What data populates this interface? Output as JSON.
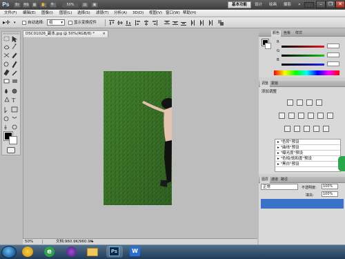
{
  "app": {
    "logo": "Ps",
    "workspace_active": "基本功能",
    "workspace_links": [
      "设计",
      "绘画",
      "摄影"
    ],
    "workspace_more": "»",
    "zoom": "50%"
  },
  "menu": {
    "items": [
      "文件(F)",
      "编辑(E)",
      "图像(I)",
      "图层(L)",
      "选择(S)",
      "滤镜(T)",
      "分析(A)",
      "3D(D)",
      "视图(V)",
      "窗口(W)",
      "帮助(H)"
    ]
  },
  "options": {
    "auto_select_label": "自动选择:",
    "auto_select_value": "组",
    "show_transform_label": "显示变换控件"
  },
  "document": {
    "tab_title": "DSC01026_副本.jpg @ 50%(RGB/8) *",
    "status_zoom": "50%",
    "status_doc": "文档:960.9K/960.9K"
  },
  "panels": {
    "color_tabs": [
      "颜色",
      "色板",
      "样式"
    ],
    "slider_labels": [
      "R",
      "G",
      "B"
    ],
    "adjust_tabs": [
      "调整",
      "蒙版"
    ],
    "adjust_title": "添加调整",
    "presets": [
      "\"色阶\"预设",
      "\"曲线\"预设",
      "\"曝光度\"预设",
      "\"色相/饱和度\"预设",
      "\"黑白\"预设"
    ],
    "layers_tabs": [
      "图层",
      "通道",
      "路径"
    ],
    "blend_mode": "正常",
    "opacity_label": "不透明度:",
    "opacity_value": "100%",
    "fill_label": "填充:",
    "fill_value": "100%"
  },
  "colors": {
    "foreground": "#000000",
    "background": "#ffffff",
    "grass": "#3d7a2a"
  },
  "taskbar": {
    "apps": [
      "ie-icon",
      "explorer-icon",
      "media-icon",
      "folder-icon",
      "photoshop-icon",
      "wps-icon"
    ],
    "ps_label": "Ps",
    "wps_label": "W"
  }
}
